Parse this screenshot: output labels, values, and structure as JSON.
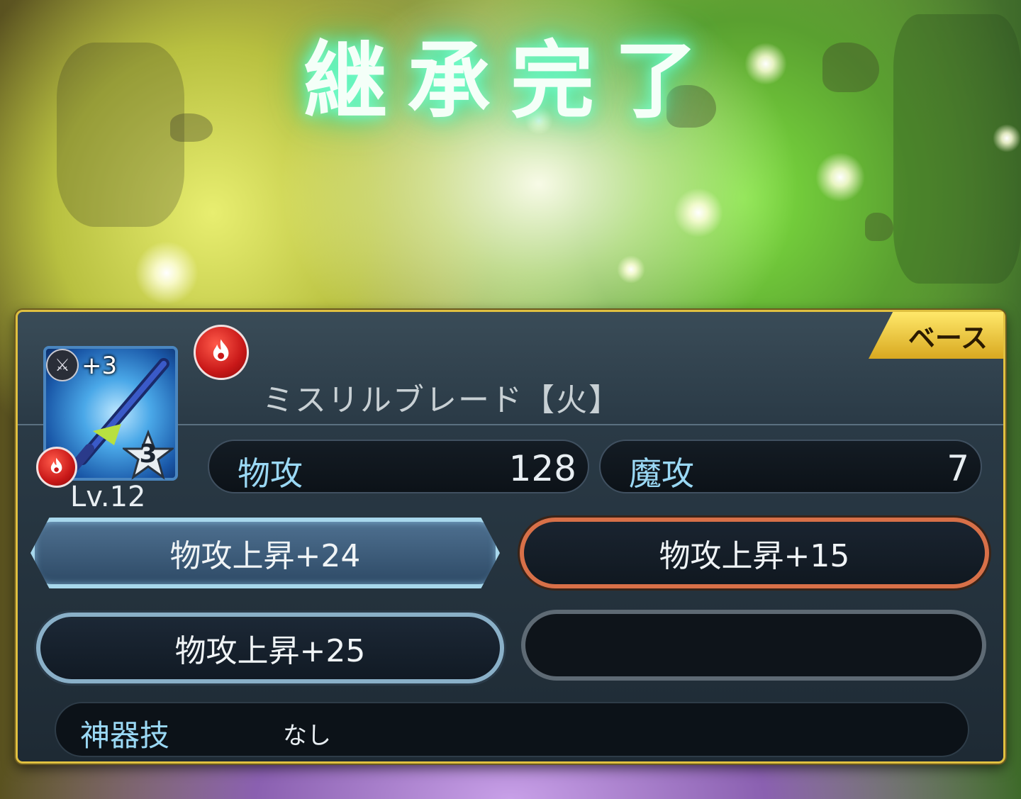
{
  "title": "継承完了",
  "panel": {
    "base_tag": "ベース",
    "item": {
      "name": "ミスリルブレード【火】",
      "plus": "+3",
      "level": "Lv.12",
      "stars": "3",
      "weapon_type_icon": "sword-icon",
      "element_icon": "fire-icon"
    },
    "stats": {
      "phys_attack_label": "物攻",
      "phys_attack_value": "128",
      "mag_attack_label": "魔攻",
      "mag_attack_value": "7"
    },
    "skills": [
      {
        "label": "物攻上昇+24",
        "style": "selected"
      },
      {
        "label": "物攻上昇+15",
        "style": "orange"
      },
      {
        "label": "物攻上昇+25",
        "style": "blue"
      },
      {
        "label": "",
        "style": "empty"
      }
    ],
    "divine": {
      "label": "神器技",
      "value": "なし"
    }
  },
  "colors": {
    "panel_border": "#e0c040",
    "stat_label": "#9ad8f4",
    "fire": "#c81818",
    "title_glow": "#40f0b0"
  }
}
